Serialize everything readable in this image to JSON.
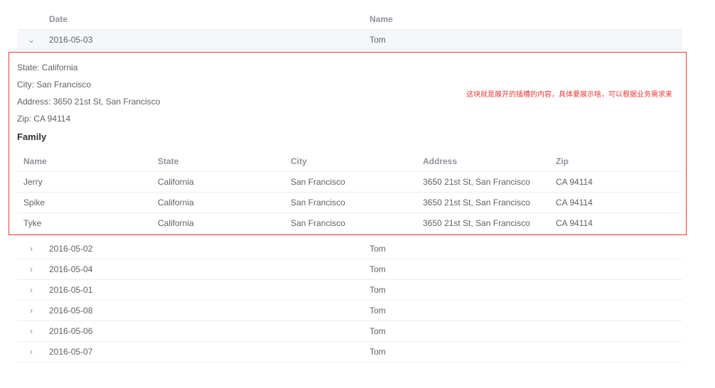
{
  "table": {
    "columns": {
      "date": "Date",
      "name": "Name"
    },
    "expanded_row": {
      "expand_icon": "chevron-down-icon",
      "date": "2016-05-03",
      "name": "Tom"
    },
    "details": {
      "state": "State: California",
      "city": "City: San Francisco",
      "address": "Address: 3650 21st St, San Francisco",
      "zip": "Zip: CA 94114",
      "family_title": "Family"
    },
    "annotation": "这块就是展开的插槽的内容，具体要展示啥，可以根据业务需求来",
    "family": {
      "columns": {
        "name": "Name",
        "state": "State",
        "city": "City",
        "address": "Address",
        "zip": "Zip"
      },
      "rows": [
        {
          "name": "Jerry",
          "state": "California",
          "city": "San Francisco",
          "address": "3650 21st St, San Francisco",
          "zip": "CA 94114"
        },
        {
          "name": "Spike",
          "state": "California",
          "city": "San Francisco",
          "address": "3650 21st St, San Francisco",
          "zip": "CA 94114"
        },
        {
          "name": "Tyke",
          "state": "California",
          "city": "San Francisco",
          "address": "3650 21st St, San Francisco",
          "zip": "CA 94114"
        }
      ]
    },
    "rows": [
      {
        "expand_icon": "chevron-right-icon",
        "date": "2016-05-02",
        "name": "Tom"
      },
      {
        "expand_icon": "chevron-right-icon",
        "date": "2016-05-04",
        "name": "Tom"
      },
      {
        "expand_icon": "chevron-right-icon",
        "date": "2016-05-01",
        "name": "Tom"
      },
      {
        "expand_icon": "chevron-right-icon",
        "date": "2016-05-08",
        "name": "Tom"
      },
      {
        "expand_icon": "chevron-right-icon",
        "date": "2016-05-06",
        "name": "Tom"
      },
      {
        "expand_icon": "chevron-right-icon",
        "date": "2016-05-07",
        "name": "Tom"
      }
    ]
  }
}
